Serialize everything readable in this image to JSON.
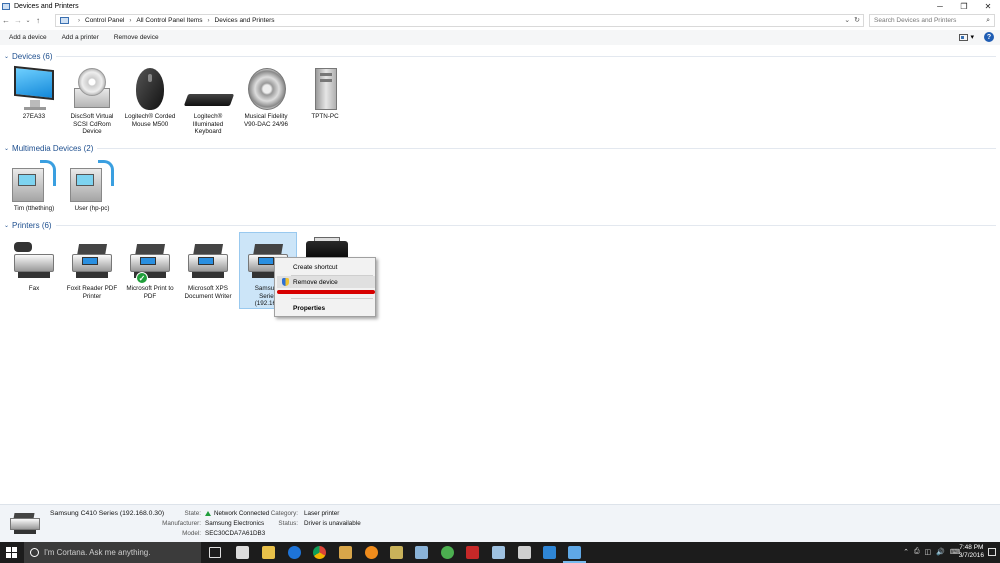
{
  "window": {
    "title": "Devices and Printers",
    "minimize": "─",
    "maximize": "❐",
    "close": "✕"
  },
  "address": {
    "back": "←",
    "forward": "→",
    "recent": "⌄",
    "up": "↑",
    "crumbs": [
      "Control Panel",
      "All Control Panel Items",
      "Devices and Printers"
    ],
    "dropdown": "⌄",
    "refresh": "↻"
  },
  "search": {
    "placeholder": "Search Devices and Printers",
    "icon": "⌕"
  },
  "commands": {
    "add_device": "Add a device",
    "add_printer": "Add a printer",
    "remove_device": "Remove device",
    "view_dropdown": "▾",
    "help": "?"
  },
  "groups": {
    "devices": {
      "label": "Devices (6)",
      "items": [
        {
          "label": "27EA33",
          "icon": "monitor-icon"
        },
        {
          "label": "DiscSoft Virtual SCSI CdRom Device",
          "icon": "cdrom-icon"
        },
        {
          "label": "Logitech® Corded Mouse M500",
          "icon": "mouse-icon"
        },
        {
          "label": "Logitech® Illuminated Keyboard",
          "icon": "keyboard-icon"
        },
        {
          "label": "Musical Fidelity V90-DAC 24/96",
          "icon": "speaker-icon"
        },
        {
          "label": "TPTN-PC",
          "icon": "computer-tower-icon"
        }
      ]
    },
    "multimedia": {
      "label": "Multimedia Devices (2)",
      "items": [
        {
          "label": "Tim (tthething)",
          "icon": "media-device-icon"
        },
        {
          "label": "User (hp-pc)",
          "icon": "media-device-icon"
        }
      ]
    },
    "printers": {
      "label": "Printers (6)",
      "items": [
        {
          "label": "Fax",
          "icon": "fax-icon"
        },
        {
          "label": "Foxit Reader PDF Printer",
          "icon": "printer-icon"
        },
        {
          "label": "Microsoft Print to PDF",
          "icon": "printer-icon",
          "default": true
        },
        {
          "label": "Microsoft XPS Document Writer",
          "icon": "printer-icon"
        },
        {
          "label": "Samsung C410 Series (192.168.0.30)",
          "label_visible": "Samsung\nSeries\n(192.168.",
          "icon": "printer-icon",
          "selected": true
        },
        {
          "label": "",
          "icon": "laser-printer-icon"
        }
      ]
    }
  },
  "context_menu": {
    "items": [
      "Create shortcut",
      "Remove device",
      "Properties"
    ]
  },
  "details": {
    "title": "Samsung C410 Series (192.168.0.30)",
    "state_label": "State:",
    "state_value": "Network Connected",
    "manufacturer_label": "Manufacturer:",
    "manufacturer_value": "Samsung Electronics",
    "model_label": "Model:",
    "model_value": "SEC30CDA7A61DB3",
    "category_label": "Category:",
    "category_value": "Laser printer",
    "status_label": "Status:",
    "status_value": "Driver is unavailable"
  },
  "taskbar": {
    "cortana_placeholder": "I'm Cortana. Ask me anything.",
    "tray_icons": [
      "⌃",
      "⎙",
      "◫",
      "🔊",
      "⌨"
    ],
    "time": "7:48 PM",
    "date": "3/7/2016"
  },
  "colors": {
    "accent": "#1e4f8f",
    "selection": "#cce5f8",
    "taskbar": "#1c1c1c",
    "highlight_red": "#d70000"
  }
}
